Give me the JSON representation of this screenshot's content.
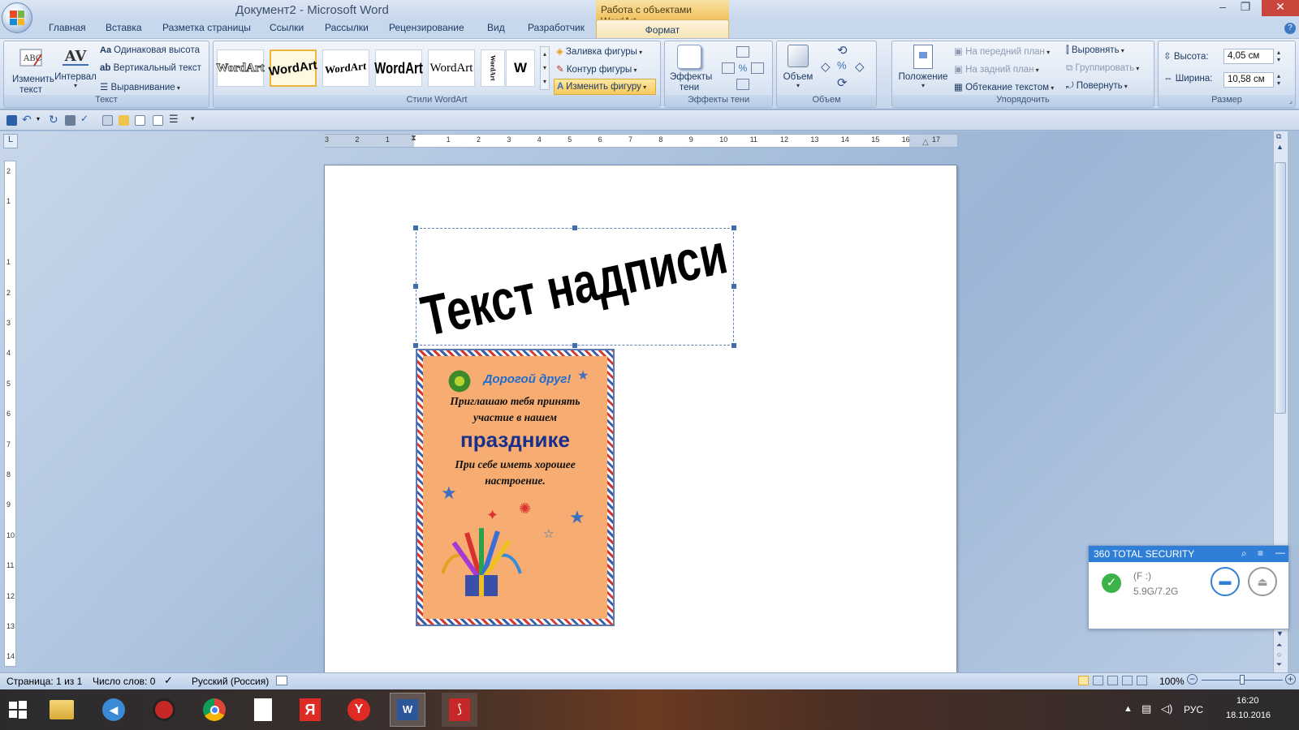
{
  "window": {
    "title": "Документ2 - Microsoft Word",
    "context_header": "Работа с объектами WordArt",
    "minimize": "–",
    "maximize": "❐",
    "close": "✕"
  },
  "tabs": [
    "Главная",
    "Вставка",
    "Разметка страницы",
    "Ссылки",
    "Рассылки",
    "Рецензирование",
    "Вид",
    "Разработчик",
    "Формат"
  ],
  "ribbon": {
    "text_group": {
      "label": "Текст",
      "edit_text": "Изменить текст",
      "edit_text_l1": "Изменить",
      "edit_text_l2": "текст",
      "spacing": "Интервал",
      "same_height": "Одинаковая высота",
      "vertical_text": "Вертикальный текст",
      "alignment": "Выравнивание"
    },
    "styles_group": {
      "label": "Стили WordArt",
      "styles": [
        "WordArt",
        "WordArt",
        "WordArt",
        "WordArt",
        "WordArt",
        "WordArt",
        "W"
      ],
      "fill": "Заливка фигуры",
      "outline": "Контур фигуры",
      "change_shape": "Изменить фигуру"
    },
    "shadow_group": {
      "label": "Эффекты тени",
      "button_l1": "Эффекты",
      "button_l2": "тени"
    },
    "volume_group": {
      "label": "Объем",
      "button": "Объем"
    },
    "arrange_group": {
      "label": "Упорядочить",
      "position": "Положение",
      "bring_front": "На передний план",
      "send_back": "На задний план",
      "text_wrap": "Обтекание текстом",
      "align": "Выровнять",
      "group": "Группировать",
      "rotate": "Повернуть"
    },
    "size_group": {
      "label": "Размер",
      "height_label": "Высота:",
      "height_value": "4,05 см",
      "width_label": "Ширина:",
      "width_value": "10,58 см"
    }
  },
  "ruler": {
    "h_numbers": [
      "3",
      "2",
      "1",
      "",
      "1",
      "2",
      "3",
      "4",
      "5",
      "6",
      "7",
      "8",
      "9",
      "10",
      "11",
      "12",
      "13",
      "14",
      "15",
      "16",
      "17"
    ],
    "v_numbers": [
      "2",
      "1",
      "",
      "1",
      "2",
      "3",
      "4",
      "5",
      "6",
      "7",
      "8",
      "9",
      "10",
      "11",
      "12",
      "13",
      "14"
    ]
  },
  "document": {
    "wordart_text": "Текст надписи",
    "card": {
      "greeting": "Дорогой друг!",
      "line1": "Приглашаю тебя принять",
      "line2": "участие в нашем",
      "headline": "празднике",
      "line3": "При себе иметь хорошее",
      "line4": "настроение."
    }
  },
  "security_popup": {
    "title": "360 TOTAL SECURITY",
    "drive": "(F :)",
    "usage": "5.9G/7.2G"
  },
  "status_bar": {
    "page": "Страница: 1 из 1",
    "words": "Число слов: 0",
    "language": "Русский (Россия)",
    "zoom": "100%"
  },
  "taskbar": {
    "language": "РУС",
    "time": "16:20",
    "date": "18.10.2016"
  }
}
